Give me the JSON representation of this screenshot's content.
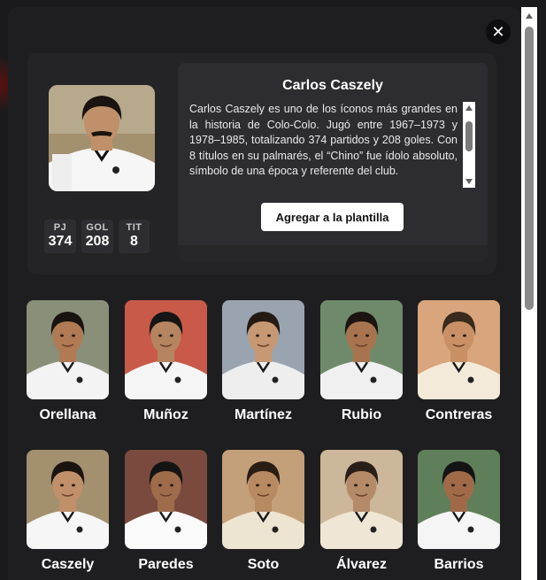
{
  "colors": {
    "modal_bg": "#1e1e20",
    "panel_bg": "#242427",
    "info_bg": "#2d2d31",
    "button_bg": "#ffffff",
    "text": "#ffffff"
  },
  "close": {
    "icon": "close-icon",
    "glyph": "✕"
  },
  "selected": {
    "name": "Carlos Caszely",
    "bio": "Carlos Caszely es uno de los íconos más grandes en la historia de Colo-Colo. Jugó entre 1967–1973 y 1978–1985, totalizando 374 partidos y 208 goles. Con 8 títulos en su palmarés, el “Chino” fue ídolo absoluto, símbolo de una época y referente del club.",
    "stats": [
      {
        "label": "PJ",
        "value": "374"
      },
      {
        "label": "GOL",
        "value": "208"
      },
      {
        "label": "TIT",
        "value": "8"
      }
    ],
    "add_button": "Agregar a la plantilla"
  },
  "players": [
    {
      "name": "Orellana",
      "skin": "#b07a55",
      "hair": "#1a1410",
      "bg": "#8a8f7a",
      "shirt": "#f3f3f3"
    },
    {
      "name": "Muñoz",
      "skin": "#b58460",
      "hair": "#151515",
      "bg": "#c95a4a",
      "shirt": "#f5f5f5"
    },
    {
      "name": "Martínez",
      "skin": "#c79874",
      "hair": "#241a14",
      "bg": "#9aa4b0",
      "shirt": "#eeeeee"
    },
    {
      "name": "Rubio",
      "skin": "#a8744f",
      "hair": "#1b1410",
      "bg": "#6f8a6a",
      "shirt": "#f0f0f0"
    },
    {
      "name": "Contreras",
      "skin": "#c99066",
      "hair": "#3a2a1e",
      "bg": "#d9a57c",
      "shirt": "#f4ead9"
    },
    {
      "name": "Caszely",
      "skin": "#c0906a",
      "hair": "#1a130f",
      "bg": "#a3906f",
      "shirt": "#f6f6f6"
    },
    {
      "name": "Paredes",
      "skin": "#9f6c4b",
      "hair": "#141414",
      "bg": "#7a4a3e",
      "shirt": "#fafafa"
    },
    {
      "name": "Soto",
      "skin": "#b88a62",
      "hair": "#2a1d14",
      "bg": "#c4a07a",
      "shirt": "#eee4d2"
    },
    {
      "name": "Álvarez",
      "skin": "#b58a68",
      "hair": "#2a1f18",
      "bg": "#cdb79a",
      "shirt": "#efe6d6"
    },
    {
      "name": "Barrios",
      "skin": "#a06a48",
      "hair": "#141414",
      "bg": "#5f7f5a",
      "shirt": "#f5f5f5"
    }
  ]
}
